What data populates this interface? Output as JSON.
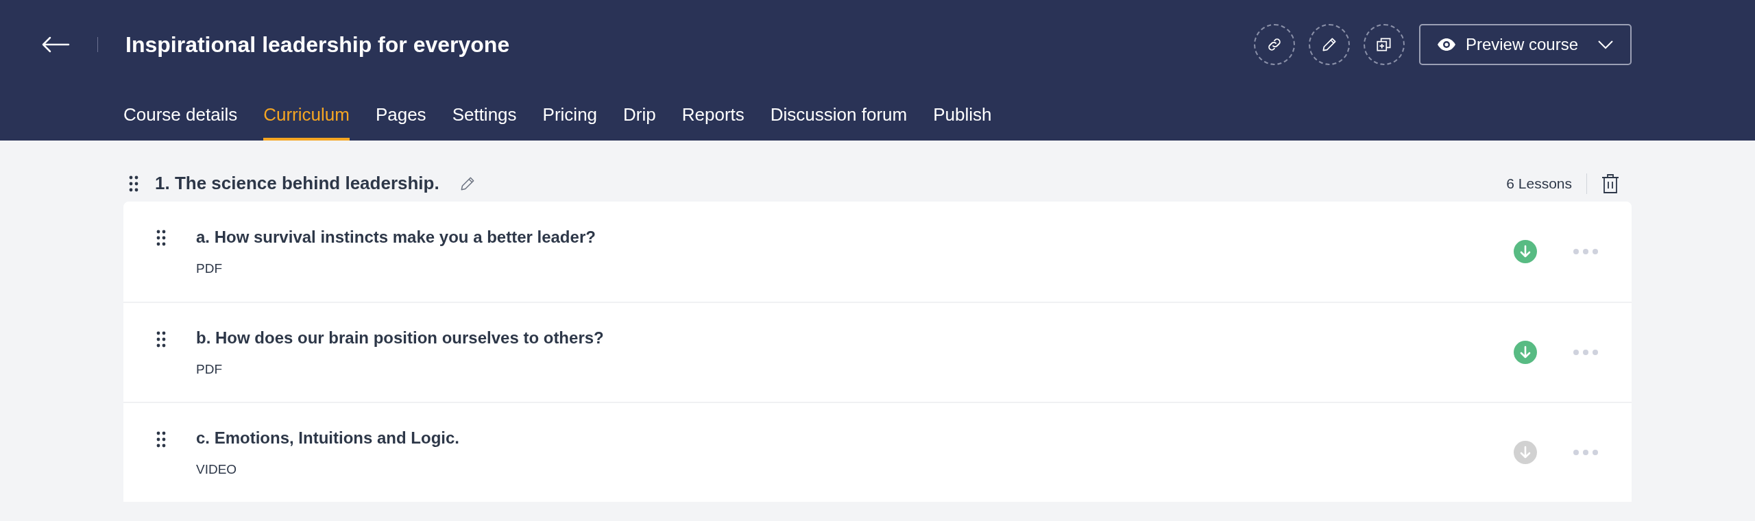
{
  "header": {
    "title": "Inspirational leadership for everyone",
    "preview_button": "Preview course"
  },
  "tabs": [
    {
      "label": "Course details",
      "selected": false
    },
    {
      "label": "Curriculum",
      "selected": true
    },
    {
      "label": "Pages",
      "selected": false
    },
    {
      "label": "Settings",
      "selected": false
    },
    {
      "label": "Pricing",
      "selected": false
    },
    {
      "label": "Drip",
      "selected": false
    },
    {
      "label": "Reports",
      "selected": false
    },
    {
      "label": "Discussion forum",
      "selected": false
    },
    {
      "label": "Publish",
      "selected": false
    }
  ],
  "section": {
    "title": "1. The science behind leadership.",
    "lesson_count": "6 Lessons",
    "lessons": [
      {
        "title": "a. How survival instincts make you a better leader?",
        "type": "PDF",
        "downloadable": true
      },
      {
        "title": "b. How does our brain position ourselves to others?",
        "type": "PDF",
        "downloadable": true
      },
      {
        "title": "c. Emotions, Intuitions and Logic.",
        "type": "VIDEO",
        "downloadable": false
      }
    ]
  }
}
